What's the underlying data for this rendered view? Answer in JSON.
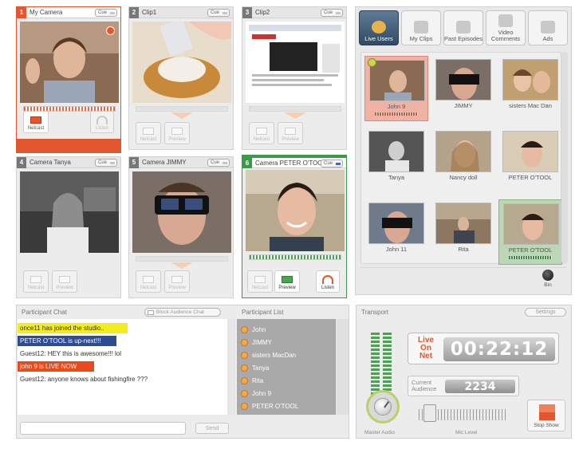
{
  "colors": {
    "accent_orange": "#e4572e",
    "live_green": "#3a9a4a",
    "chat_next_blue": "#2e4b96",
    "chat_join_yellow": "#f4ec1d"
  },
  "cameras": [
    {
      "num": "1",
      "title": "My Camera",
      "cue": "Cue",
      "netcast": "Netcast",
      "listen": "Listen"
    },
    {
      "num": "2",
      "title": "Clip1",
      "cue": "Cue",
      "netcast": "Netcast",
      "preview": "Preview"
    },
    {
      "num": "3",
      "title": "Clip2",
      "cue": "Cue",
      "netcast": "Netcast",
      "preview": "Preview"
    },
    {
      "num": "4",
      "title": "Camera Tanya",
      "cue": "Cue",
      "netcast": "Netcast",
      "preview": "Preview"
    },
    {
      "num": "5",
      "title": "Camera JIMMY",
      "cue": "Cue",
      "netcast": "Netcast",
      "preview": "Preview"
    },
    {
      "num": "6",
      "title": "Camera PETER O'TOOL",
      "cue": "Cue",
      "netcast": "Netcast",
      "preview": "Preview",
      "listen": "Listen"
    }
  ],
  "library": {
    "tabs": [
      {
        "label": "Live Users",
        "icon": "users-icon"
      },
      {
        "label": "My Clips",
        "icon": "clapper-icon"
      },
      {
        "label": "Past Episodes",
        "icon": "episodes-icon"
      },
      {
        "label": "Video Comments",
        "icon": "comment-icon"
      },
      {
        "label": "Ads",
        "icon": "ads-icon"
      }
    ],
    "users": [
      {
        "name": "John 9"
      },
      {
        "name": "JIMMY"
      },
      {
        "name": "sisters Mac Dan"
      },
      {
        "name": "Tanya"
      },
      {
        "name": "Nancy doll"
      },
      {
        "name": "PETER O'TOOL"
      },
      {
        "name": "John 11"
      },
      {
        "name": "Rita"
      },
      {
        "name": "PETER O'TOOL"
      }
    ],
    "bin_label": "Bin"
  },
  "chat": {
    "title": "Participant Chat",
    "block_label": "Block Audience Chat",
    "participant_list_title": "Participant List",
    "messages": [
      "once11 has joined the studio..",
      "PETER O'TOOL is up-next!!!",
      "Guest12: HEY this is awesome!!! lol",
      "john 9  is LIVE NOW",
      "Guest12: anyone knows about fishingfire ???"
    ],
    "participants": [
      "John",
      "JIMMY",
      "sisters MacDan",
      "Tanya",
      "Rita",
      "John 9",
      "PETER O'TOOL"
    ],
    "input_value": "",
    "send_label": "Send"
  },
  "transport": {
    "title": "Transport",
    "settings_label": "Settings",
    "live_line1": "Live",
    "live_line2": "On",
    "live_line3": "Net",
    "clock": "00:22:12",
    "audience_label1": "Current",
    "audience_label2": "Audience",
    "audience_count": "2234",
    "master_label": "Master Audio",
    "mic_label": "Mic Level",
    "stop_label": "Stop Show"
  }
}
